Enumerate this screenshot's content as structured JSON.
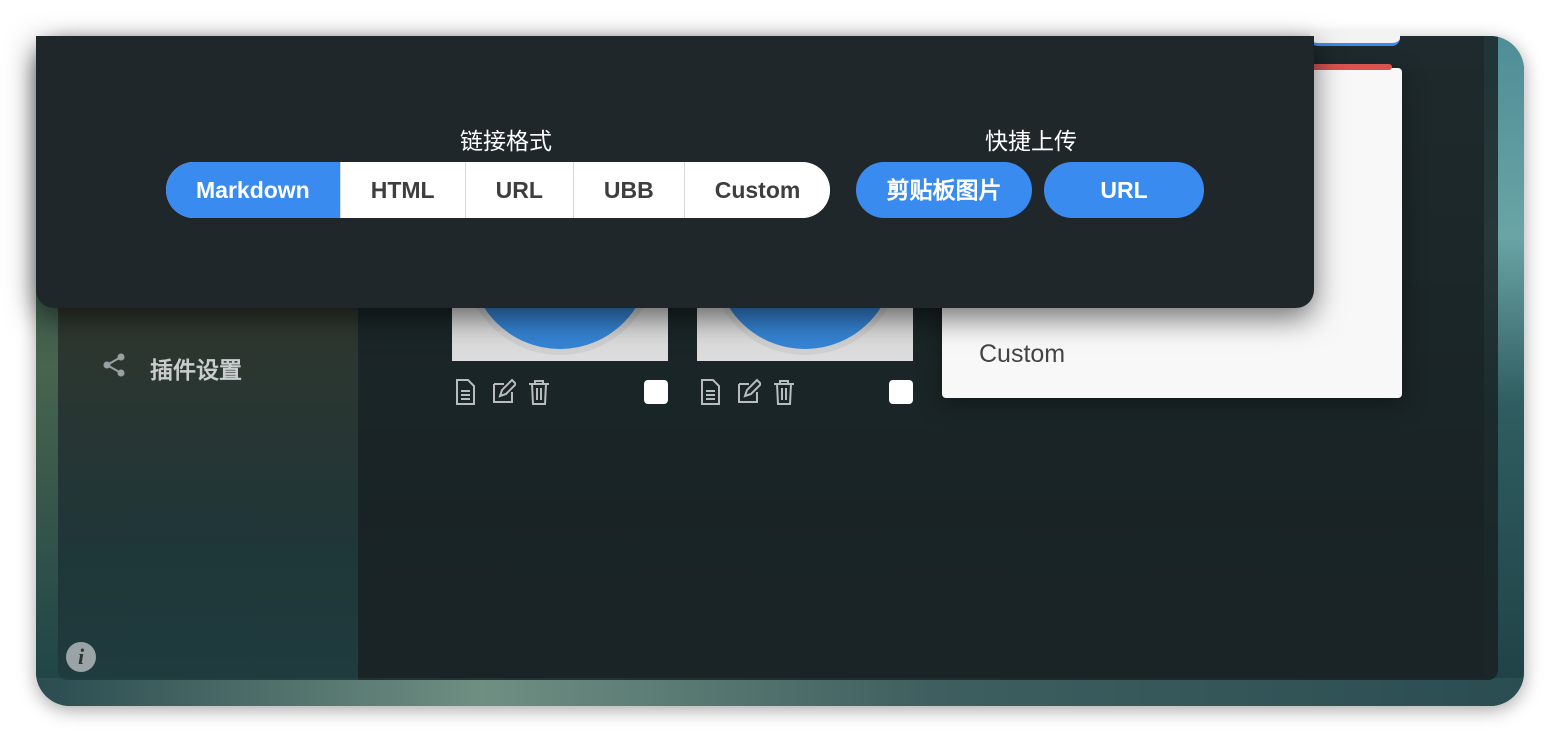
{
  "sidebar": {
    "plugin_settings": {
      "label": "插件设置",
      "icon": "share-icon"
    },
    "info_icon": "i"
  },
  "gallery": {
    "cards": [
      {
        "actions": [
          "file-text-icon",
          "edit-icon",
          "trash-icon"
        ],
        "checked": false
      },
      {
        "actions": [
          "file-text-icon",
          "edit-icon",
          "trash-icon"
        ],
        "checked": false
      }
    ]
  },
  "panel": {
    "custom_label": "Custom"
  },
  "overlay": {
    "link_format": {
      "label": "链接格式",
      "options": [
        "Markdown",
        "HTML",
        "URL",
        "UBB",
        "Custom"
      ],
      "selected": "Markdown"
    },
    "quick_upload": {
      "label": "快捷上传",
      "buttons": [
        "剪贴板图片",
        "URL"
      ]
    }
  },
  "colors": {
    "accent": "#3a8bf0",
    "overlay_bg": "#20272b",
    "danger": "#d9534f"
  }
}
